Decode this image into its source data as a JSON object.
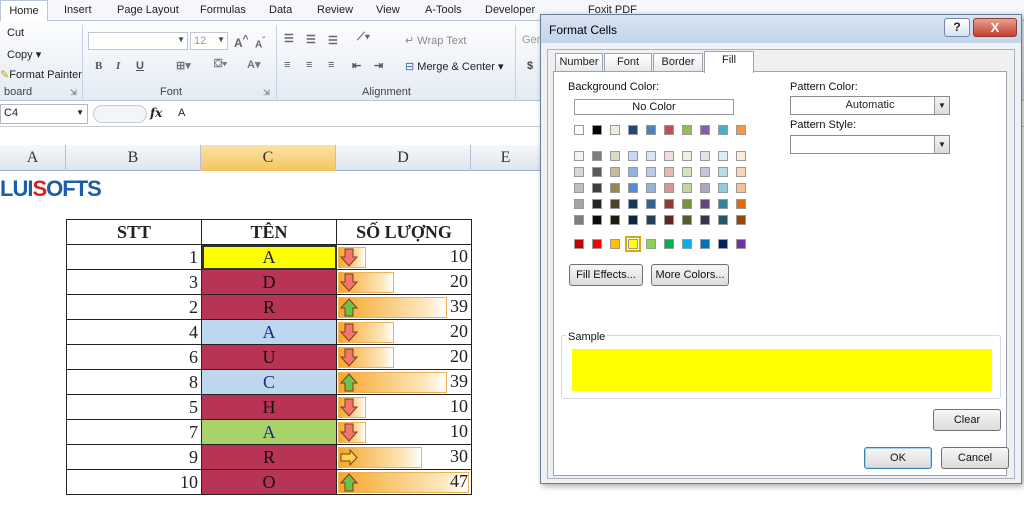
{
  "ribbon": {
    "tabs": [
      "Home",
      "Insert",
      "Page Layout",
      "Formulas",
      "Data",
      "Review",
      "View",
      "A-Tools",
      "Developer",
      "Foxit PDF"
    ],
    "clipboard": {
      "cut": "Cut",
      "copy": "Copy",
      "format_painter": "Format Painter",
      "label": "board"
    },
    "font": {
      "size": "12",
      "label": "Font"
    },
    "alignment": {
      "wrap_text": "Wrap Text",
      "merge_center": "Merge & Center",
      "label": "Alignment"
    },
    "number": {
      "general": "Gen"
    }
  },
  "formula_bar": {
    "name_box": "C4",
    "fx": "fx",
    "value": "A"
  },
  "columns": [
    "A",
    "B",
    "C",
    "D",
    "E"
  ],
  "logo": {
    "part1": "LUI",
    "part2": "S",
    "part3": "OFTS"
  },
  "table": {
    "headers": [
      "STT",
      "TÊN",
      "SỐ LƯỢNG"
    ],
    "rows": [
      {
        "stt": "1",
        "ten": "A",
        "qty": "10",
        "fill": "#ffff00",
        "arrow": "down"
      },
      {
        "stt": "3",
        "ten": "D",
        "qty": "20",
        "fill": "#b83455",
        "arrow": "down"
      },
      {
        "stt": "2",
        "ten": "R",
        "qty": "39",
        "fill": "#b83455",
        "arrow": "up"
      },
      {
        "stt": "4",
        "ten": "A",
        "qty": "20",
        "fill": "#bdd7ee",
        "arrow": "down"
      },
      {
        "stt": "6",
        "ten": "U",
        "qty": "20",
        "fill": "#b83455",
        "arrow": "down"
      },
      {
        "stt": "8",
        "ten": "C",
        "qty": "39",
        "fill": "#bdd7ee",
        "arrow": "up"
      },
      {
        "stt": "5",
        "ten": "H",
        "qty": "10",
        "fill": "#b83455",
        "arrow": "down"
      },
      {
        "stt": "7",
        "ten": "A",
        "qty": "10",
        "fill": "#a9d26a",
        "arrow": "down"
      },
      {
        "stt": "9",
        "ten": "R",
        "qty": "30",
        "fill": "#b83455",
        "arrow": "right"
      },
      {
        "stt": "10",
        "ten": "O",
        "qty": "47",
        "fill": "#b83455",
        "arrow": "up"
      }
    ]
  },
  "dialog": {
    "title": "Format Cells",
    "help": "?",
    "close": "X",
    "tabs": [
      "Number",
      "Font",
      "Border",
      "Fill"
    ],
    "background_color_label": "Background Color:",
    "no_color": "No Color",
    "fill_effects": "Fill Effects...",
    "more_colors": "More Colors...",
    "pattern_color_label": "Pattern Color:",
    "pattern_color_value": "Automatic",
    "pattern_style_label": "Pattern Style:",
    "pattern_style_value": "",
    "sample_label": "Sample",
    "sample_color": "#ffff00",
    "clear": "Clear",
    "ok": "OK",
    "cancel": "Cancel",
    "theme_colors": [
      [
        "#ffffff",
        "#000000",
        "#eeece1",
        "#1f497d",
        "#4f81bd",
        "#c0504d",
        "#9bbb59",
        "#8064a2",
        "#4bacc6",
        "#f79646"
      ],
      [
        "#f2f2f2",
        "#7f7f7f",
        "#ddd9c3",
        "#c6d9f0",
        "#dbe5f1",
        "#f2dcdb",
        "#ebf1dd",
        "#e5e0ec",
        "#dbeef3",
        "#fdeada"
      ],
      [
        "#d8d8d8",
        "#595959",
        "#c4bd97",
        "#8db3e2",
        "#b8cce4",
        "#e5b9b7",
        "#d7e3bc",
        "#ccc1d9",
        "#b7dde8",
        "#fbd5b5"
      ],
      [
        "#bfbfbf",
        "#3f3f3f",
        "#938953",
        "#548dd4",
        "#95b3d7",
        "#d99694",
        "#c3d69b",
        "#b2a2c7",
        "#92cddc",
        "#fac08f"
      ],
      [
        "#a5a5a5",
        "#262626",
        "#494429",
        "#17365d",
        "#366092",
        "#953734",
        "#76923c",
        "#5f497a",
        "#31859b",
        "#e36c09"
      ],
      [
        "#7f7f7f",
        "#0c0c0c",
        "#1d1b10",
        "#0f243e",
        "#244061",
        "#632423",
        "#4f6128",
        "#3f3151",
        "#205867",
        "#974806"
      ]
    ],
    "standard_colors": [
      "#c00000",
      "#ff0000",
      "#ffc000",
      "#ffff00",
      "#92d050",
      "#00b050",
      "#00b0f0",
      "#0070c0",
      "#002060",
      "#7030a0"
    ],
    "selected_standard_index": 3
  }
}
